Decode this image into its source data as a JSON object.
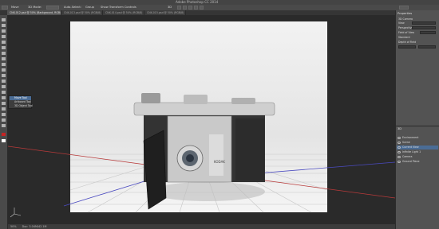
{
  "window": {
    "title": "Adobe Photoshop CC 2014"
  },
  "options_bar": {
    "items": [
      "Move",
      "3D Mode:",
      "Auto-Select:",
      "Group",
      "Show Transform Controls"
    ],
    "right": "3D"
  },
  "tabs": [
    "CNX-012.psd @ 50% (Background, RGB/8)",
    "CNX-013.psd @ 50% (RGB/8)",
    "CNX-014.psd @ 50% (RGB/8)",
    "CNX-015.psd @ 50% (RGB/8)"
  ],
  "flyout": {
    "items": [
      "Move Tool",
      "Artboard Tool",
      "3D Object Tool"
    ]
  },
  "status": {
    "zoom": "50%",
    "doc": "Doc: 3.04M/42.1M"
  },
  "properties": {
    "header": "Properties",
    "section": "3D Camera",
    "rows": [
      "View",
      "Perspective",
      "Field of View",
      "Standard",
      "Depth of Field"
    ],
    "tab2": "Properties"
  },
  "layers": {
    "header": "3D",
    "items": [
      "Environment",
      "Scene",
      "Current View",
      "Infinite Light 1",
      "Camera",
      "Ground Plane"
    ]
  },
  "canvas": {
    "brand": "KODAK"
  }
}
